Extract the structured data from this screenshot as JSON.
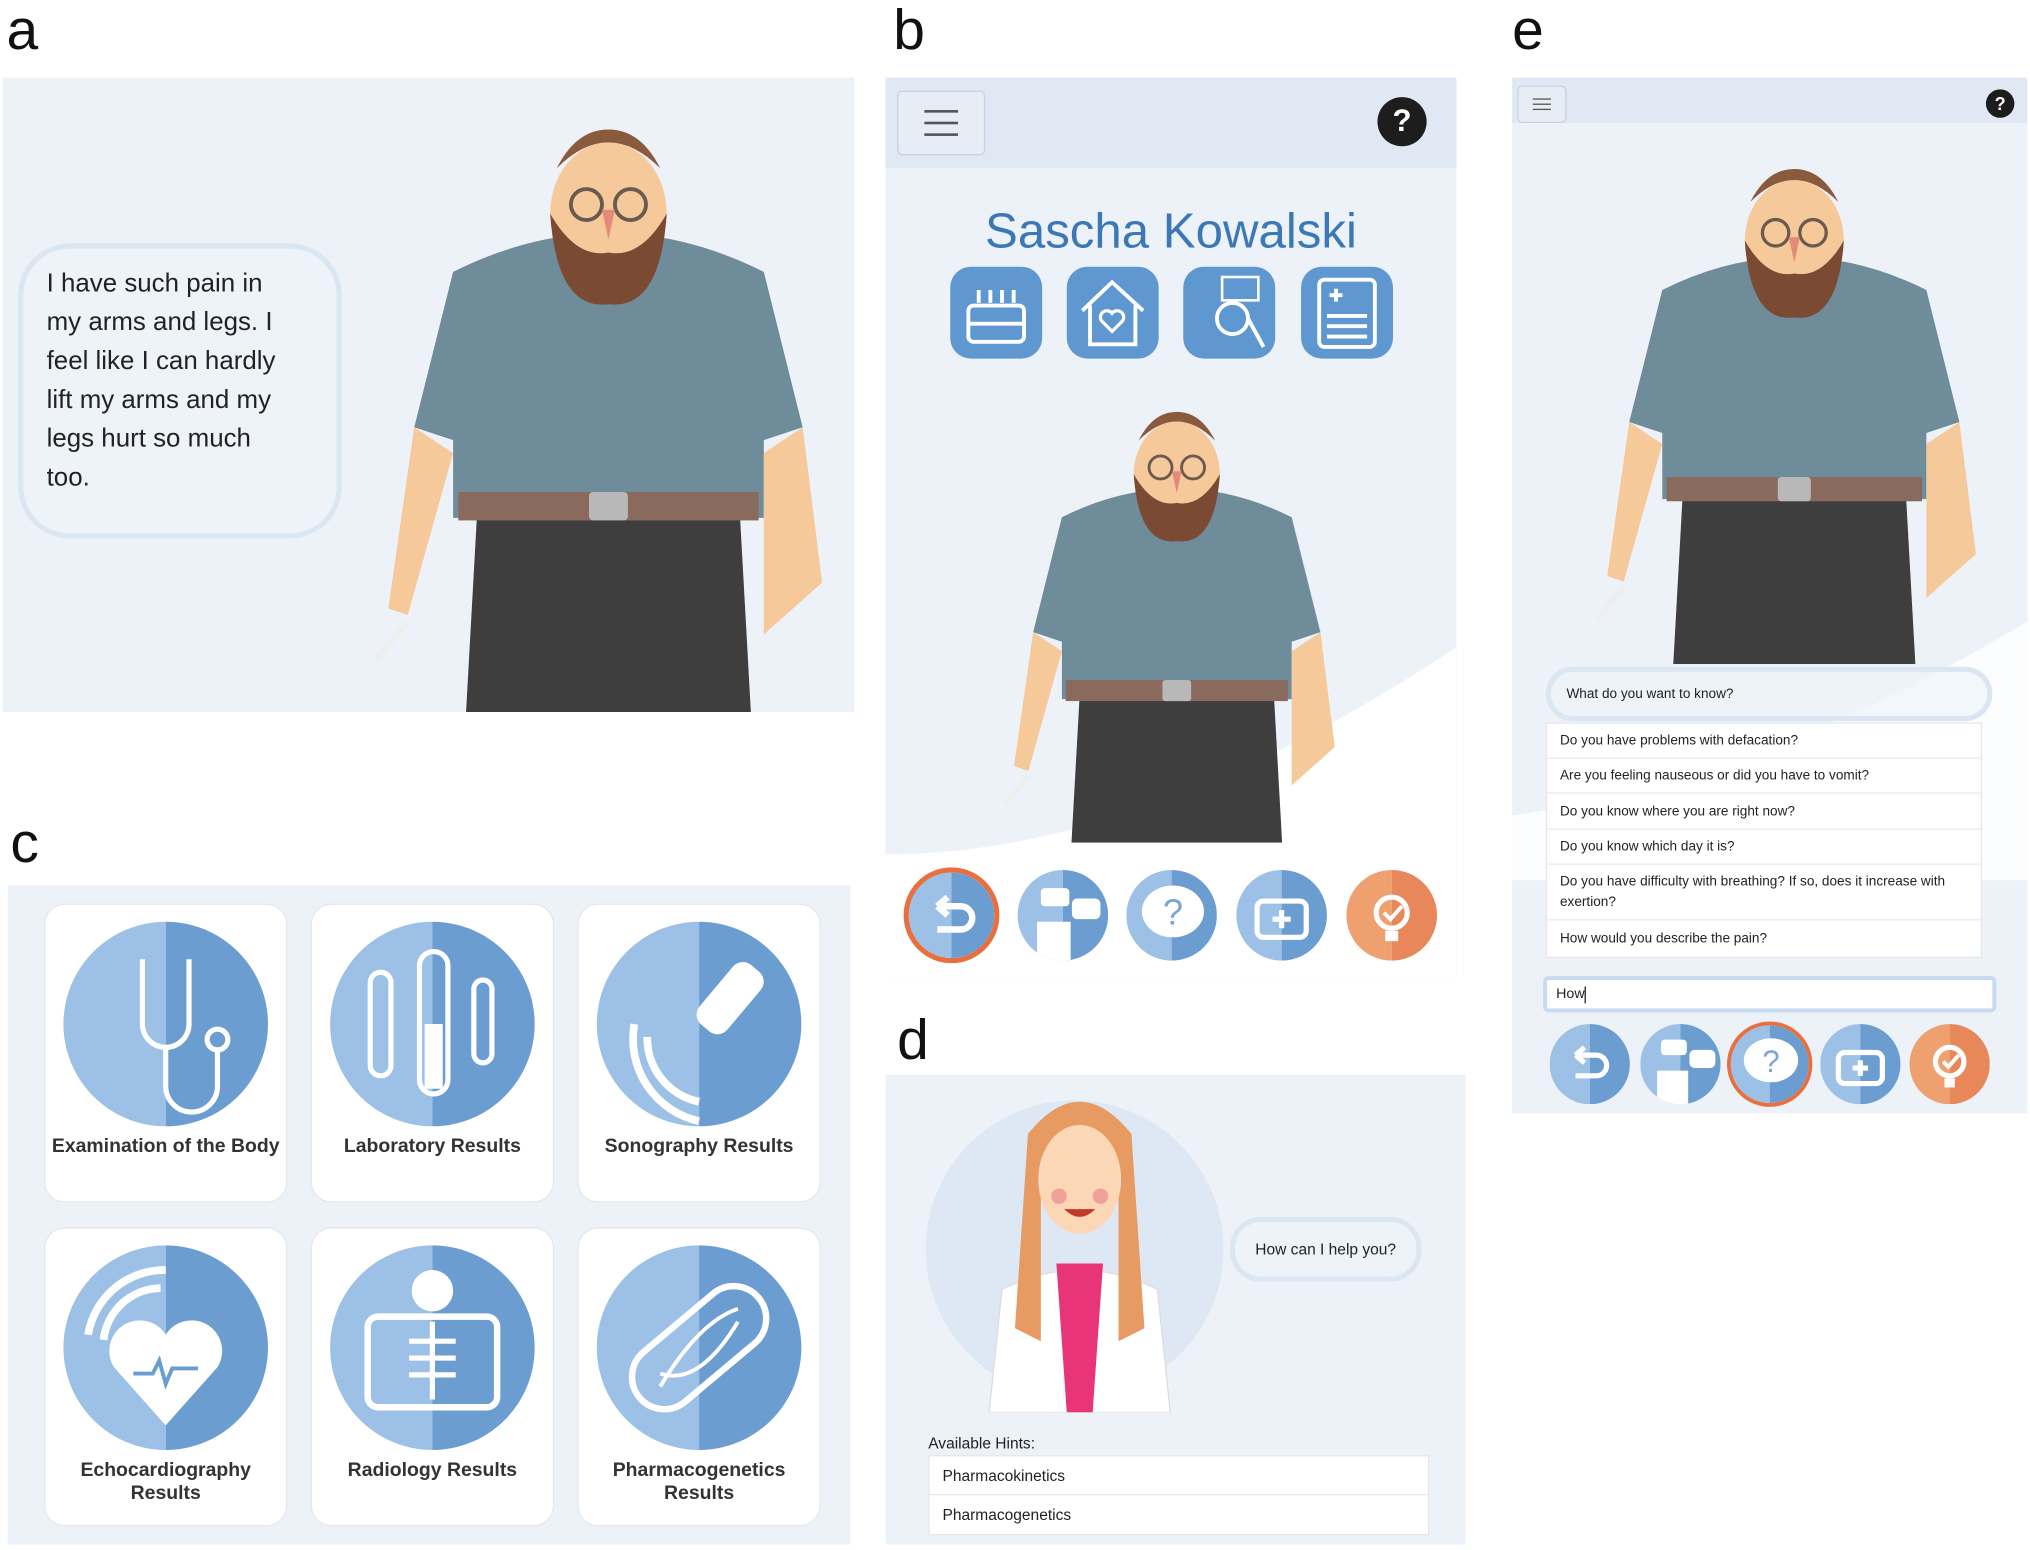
{
  "panel_labels": {
    "a": "a",
    "b": "b",
    "c": "c",
    "d": "d",
    "e": "e"
  },
  "panel_a": {
    "speech_lines": [
      "I have such pain in",
      "my arms and legs. I",
      "feel like I can hardly",
      "lift my arms and my",
      "legs hurt so much",
      "too."
    ]
  },
  "panel_b": {
    "menu_icon": "hamburger-icon",
    "help_label": "?",
    "patient_name": "Sascha Kowalski",
    "info_icons": [
      "birthday-cake-icon",
      "home-heart-icon",
      "hobbies-icon",
      "medical-record-icon"
    ],
    "action_buttons": [
      "back-icon",
      "doctor-conversation-icon",
      "question-bubble-icon",
      "first-aid-kit-icon",
      "lightbulb-check-icon"
    ],
    "active_button": "back-icon"
  },
  "panel_c": {
    "cards": [
      {
        "label": "Examination of the Body",
        "icon": "stethoscope-icon"
      },
      {
        "label": "Laboratory Results",
        "icon": "test-tubes-icon"
      },
      {
        "label": "Sonography Results",
        "icon": "ultrasound-probe-icon"
      },
      {
        "label": "Echocardiography Results",
        "icon": "heart-echo-icon"
      },
      {
        "label": "Radiology Results",
        "icon": "xray-icon"
      },
      {
        "label": "Pharmacogenetics Results",
        "icon": "dna-pill-icon"
      }
    ]
  },
  "panel_d": {
    "doctor_speech": "How can I help you?",
    "hints_label": "Available Hints:",
    "hints": [
      "Pharmacokinetics",
      "Pharmacogenetics"
    ]
  },
  "panel_e": {
    "help_label": "?",
    "prompt": "What do you want to know?",
    "questions": [
      "Do you have problems with defacation?",
      "Are you feeling nauseous or did you have to vomit?",
      "Do you know where you are right now?",
      "Do you know which day it is?",
      "Do you have difficulty with breathing? If so, does it increase with exertion?",
      "How would you describe the pain?"
    ],
    "input_value": "How",
    "active_button": "question-bubble-icon"
  },
  "colors": {
    "accent_blue": "#3b78b5",
    "icon_blue": "#6b9dd1",
    "icon_light": "#9cc0e6",
    "orange": "#e8875a",
    "panel_bg": "#edf2f8"
  }
}
